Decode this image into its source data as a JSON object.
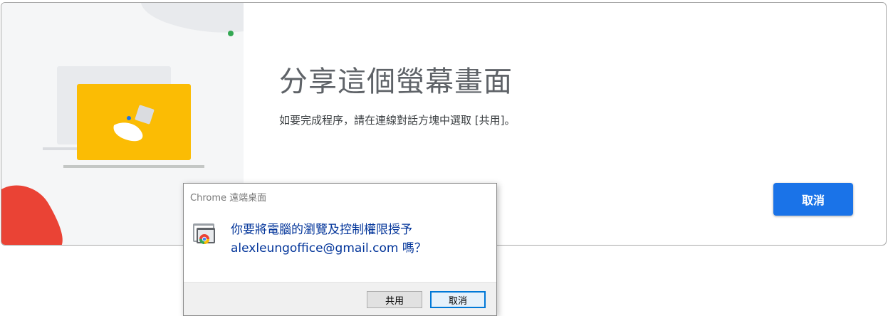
{
  "share_card": {
    "title": "分享這個螢幕畫面",
    "description": "如要完成程序，請在連線對話方塊中選取 [共用]。",
    "cancel_label": "取消"
  },
  "dialog": {
    "title": "Chrome 遠端桌面",
    "message_line1": "你要將電腦的瀏覽及控制權限授予",
    "message_line2": "alexleungoffice@gmail.com 嗎？",
    "share_label": "共用",
    "cancel_label": "取消"
  },
  "colors": {
    "primary_button": "#1a73e8",
    "illustration_yellow": "#fbbc04",
    "illustration_red": "#ea4335",
    "status_dot": "#34a853",
    "dialog_text": "#003399"
  },
  "icons": {
    "illustration": "screen-share-illustration",
    "app_icon": "chrome-remote-desktop-icon"
  }
}
